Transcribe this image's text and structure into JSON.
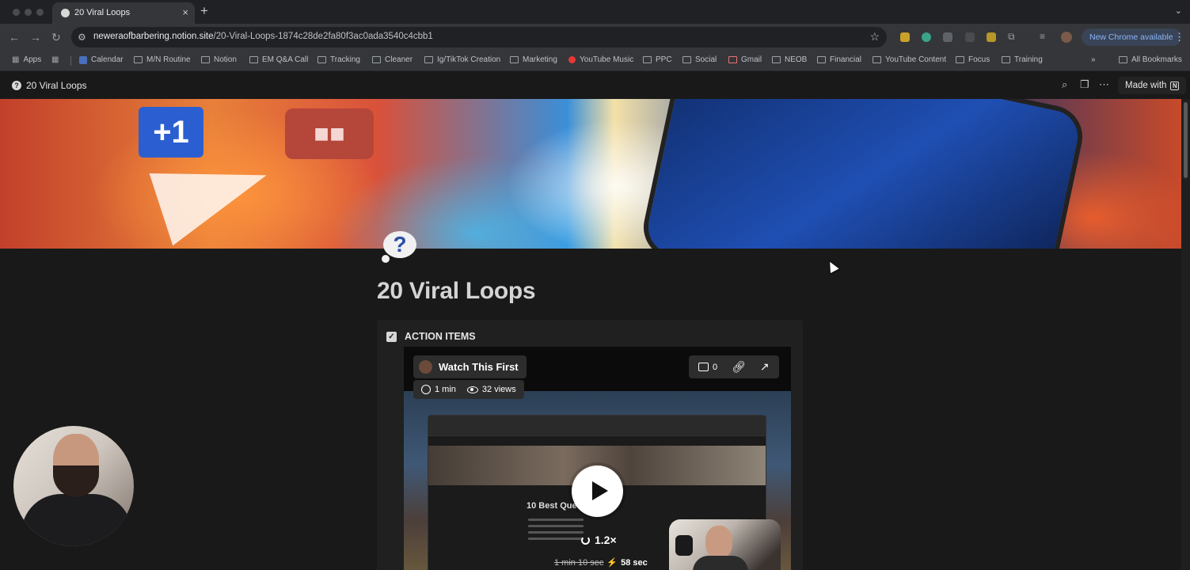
{
  "browser": {
    "tab": {
      "title": "20 Viral Loops"
    },
    "url_host": "neweraofbarbering.notion.site",
    "url_path": "/20-Viral-Loops-1874c28de2fa80f3ac0ada3540c4cbb1",
    "update_label": "New Chrome available"
  },
  "bookmarks": [
    "Apps",
    "Calendar",
    "M/N Routine",
    "Notion",
    "EM Q&A Call",
    "Tracking",
    "Cleaner",
    "Ig/TikTok Creation",
    "Marketing",
    "YouTube Music",
    "PPC",
    "Social",
    "Gmail",
    "NEOB",
    "Financial",
    "YouTube Content",
    "Focus",
    "Training"
  ],
  "bookmarks_all": "All Bookmarks",
  "notion": {
    "breadcrumb": "20 Viral Loops",
    "made_with": "Made with",
    "page_title": "20 Viral Loops",
    "callout": {
      "title": "ACTION ITEMS",
      "checked": true
    }
  },
  "video": {
    "title": "Watch This First",
    "duration": "1 min",
    "views": "32 views",
    "comments": "0",
    "inner_heading": "10 Best Ques",
    "speed": "1.2×",
    "duration_original": "1 min 10 sec",
    "duration_fast": "58 sec"
  },
  "colors": {
    "page_bg": "#191919",
    "chrome_toolbar": "#35363a",
    "update_pill_bg": "#394457",
    "update_pill_text": "#8ab4f8"
  },
  "icons": {
    "search": "search-icon",
    "duplicate": "duplicate-icon",
    "more": "more-icon",
    "link": "link-icon",
    "open": "open-external-icon",
    "play": "play-icon"
  }
}
